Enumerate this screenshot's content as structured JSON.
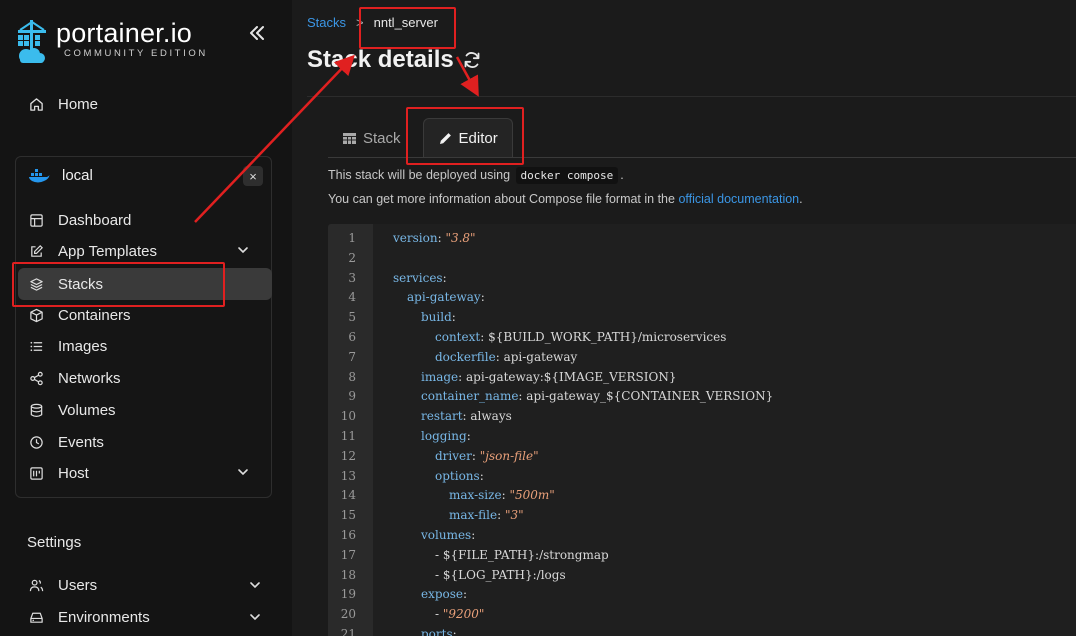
{
  "sidebar": {
    "logo": {
      "main": "portainer.io",
      "sub": "COMMUNITY EDITION"
    },
    "home": "Home",
    "environment": {
      "name": "local",
      "close": "×"
    },
    "env_items": [
      {
        "label": "Dashboard",
        "icon": "dashboard-icon"
      },
      {
        "label": "App Templates",
        "icon": "edit-icon",
        "has_chevron": true
      },
      {
        "label": "Stacks",
        "icon": "layers-icon",
        "active": true
      },
      {
        "label": "Containers",
        "icon": "box-icon"
      },
      {
        "label": "Images",
        "icon": "list-icon"
      },
      {
        "label": "Networks",
        "icon": "share-icon"
      },
      {
        "label": "Volumes",
        "icon": "database-icon"
      },
      {
        "label": "Events",
        "icon": "clock-icon"
      },
      {
        "label": "Host",
        "icon": "server-icon",
        "has_chevron": true
      }
    ],
    "settings_title": "Settings",
    "settings_items": [
      {
        "label": "Users",
        "has_chevron": true
      },
      {
        "label": "Environments",
        "has_chevron": true
      }
    ]
  },
  "main": {
    "breadcrumb": {
      "root": "Stacks",
      "separator": ">",
      "current": "nntl_server"
    },
    "title": "Stack details",
    "tabs": [
      {
        "label": "Stack",
        "active": false
      },
      {
        "label": "Editor",
        "active": true
      }
    ],
    "info_line1_pre": "This stack will be deployed using",
    "info_line1_code": "docker compose",
    "info_line1_post": ".",
    "info_line2_pre": "You can get more information about Compose file format in the",
    "info_line2_link": "official documentation",
    "info_line2_post": "."
  },
  "editor": {
    "lines": [
      {
        "n": "1",
        "indent": 0,
        "key": "version",
        "value": "\"3.8\"",
        "type": "str"
      },
      {
        "n": "2",
        "indent": 0,
        "key": "",
        "value": "",
        "type": "blank"
      },
      {
        "n": "3",
        "indent": 0,
        "key": "services",
        "value": "",
        "type": "key"
      },
      {
        "n": "4",
        "indent": 1,
        "key": "api-gateway",
        "value": "",
        "type": "key"
      },
      {
        "n": "5",
        "indent": 2,
        "key": "build",
        "value": "",
        "type": "key"
      },
      {
        "n": "6",
        "indent": 3,
        "key": "context",
        "value": "${BUILD_WORK_PATH}/microservices",
        "type": "plain"
      },
      {
        "n": "7",
        "indent": 3,
        "key": "dockerfile",
        "value": "api-gateway",
        "type": "plain"
      },
      {
        "n": "8",
        "indent": 2,
        "key": "image",
        "value": "api-gateway:${IMAGE_VERSION}",
        "type": "plain"
      },
      {
        "n": "9",
        "indent": 2,
        "key": "container_name",
        "value": "api-gateway_${CONTAINER_VERSION}",
        "type": "plain"
      },
      {
        "n": "10",
        "indent": 2,
        "key": "restart",
        "value": "always",
        "type": "plain"
      },
      {
        "n": "11",
        "indent": 2,
        "key": "logging",
        "value": "",
        "type": "key"
      },
      {
        "n": "12",
        "indent": 3,
        "key": "driver",
        "value": "\"json-file\"",
        "type": "str"
      },
      {
        "n": "13",
        "indent": 3,
        "key": "options",
        "value": "",
        "type": "key"
      },
      {
        "n": "14",
        "indent": 4,
        "key": "max-size",
        "value": "\"500m\"",
        "type": "str"
      },
      {
        "n": "15",
        "indent": 4,
        "key": "max-file",
        "value": "\"3\"",
        "type": "str"
      },
      {
        "n": "16",
        "indent": 2,
        "key": "volumes",
        "value": "",
        "type": "key"
      },
      {
        "n": "17",
        "indent": 3,
        "key": "",
        "value": "- ${FILE_PATH}:/strongmap",
        "type": "list"
      },
      {
        "n": "18",
        "indent": 3,
        "key": "",
        "value": "- ${LOG_PATH}:/logs",
        "type": "list"
      },
      {
        "n": "19",
        "indent": 2,
        "key": "expose",
        "value": "",
        "type": "key"
      },
      {
        "n": "20",
        "indent": 3,
        "key": "",
        "value": "\"9200\"",
        "type": "liststr"
      },
      {
        "n": "21",
        "indent": 2,
        "key": "ports",
        "value": "",
        "type": "key"
      }
    ]
  },
  "colors": {
    "annotation": "#e02020",
    "link": "#3b96e5",
    "active_item": "#3a3a3a"
  }
}
